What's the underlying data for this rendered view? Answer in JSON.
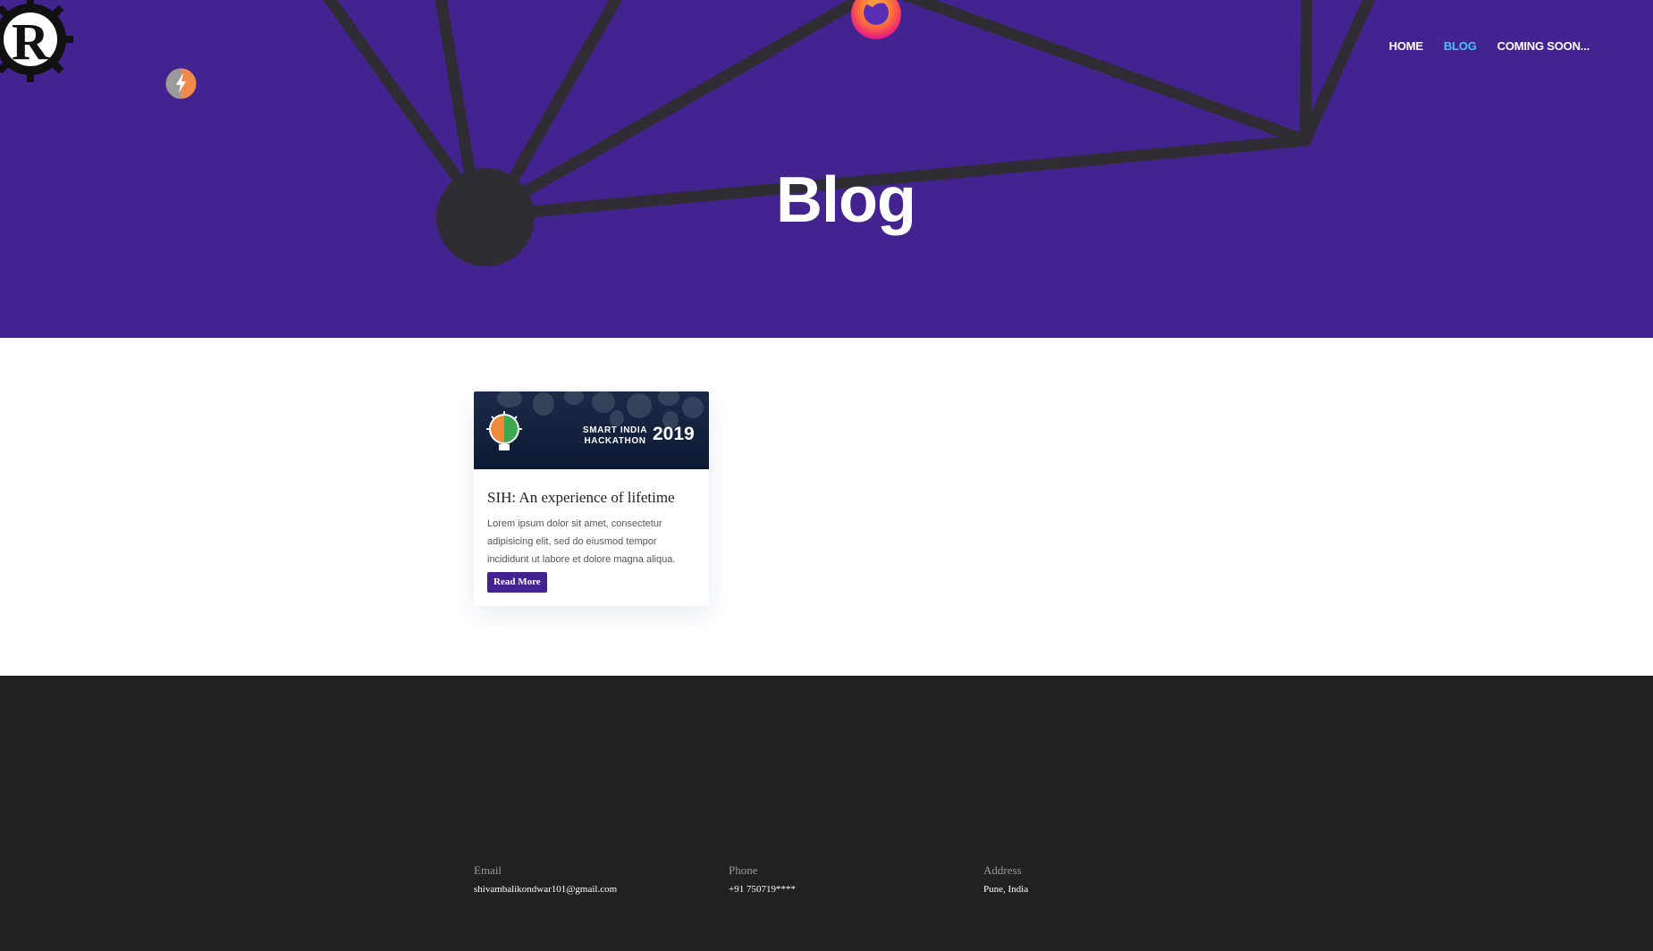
{
  "nav": {
    "items": [
      {
        "label": "HOME"
      },
      {
        "label": "BLOG",
        "active": true
      },
      {
        "label": "COMING SOON..."
      }
    ]
  },
  "hero": {
    "title": "Blog",
    "background_color": "#43238f",
    "icons": [
      "rust-logo-icon",
      "lightning-node-icon",
      "firefox-icon"
    ]
  },
  "blog": {
    "posts": [
      {
        "image": {
          "line1": "SMART INDIA",
          "line2": "HACKATHON",
          "year": "2019"
        },
        "title": "SIH: An experience of lifetime",
        "excerpt": "Lorem ipsum dolor sit amet, consectetur adipisicing elit, sed do eiusmod tempor incididunt ut labore et dolore magna aliqua.",
        "button_label": "Read More"
      }
    ]
  },
  "footer": {
    "email_label": "Email",
    "email_value": "shivambalikondwar101@gmail.com",
    "phone_label": "Phone",
    "phone_value": "+91 750719****",
    "address_label": "Address",
    "address_value": "Pune, India"
  },
  "colors": {
    "accent": "#43238f",
    "nav_active": "#40c8f4",
    "footer_bg": "#212121"
  }
}
